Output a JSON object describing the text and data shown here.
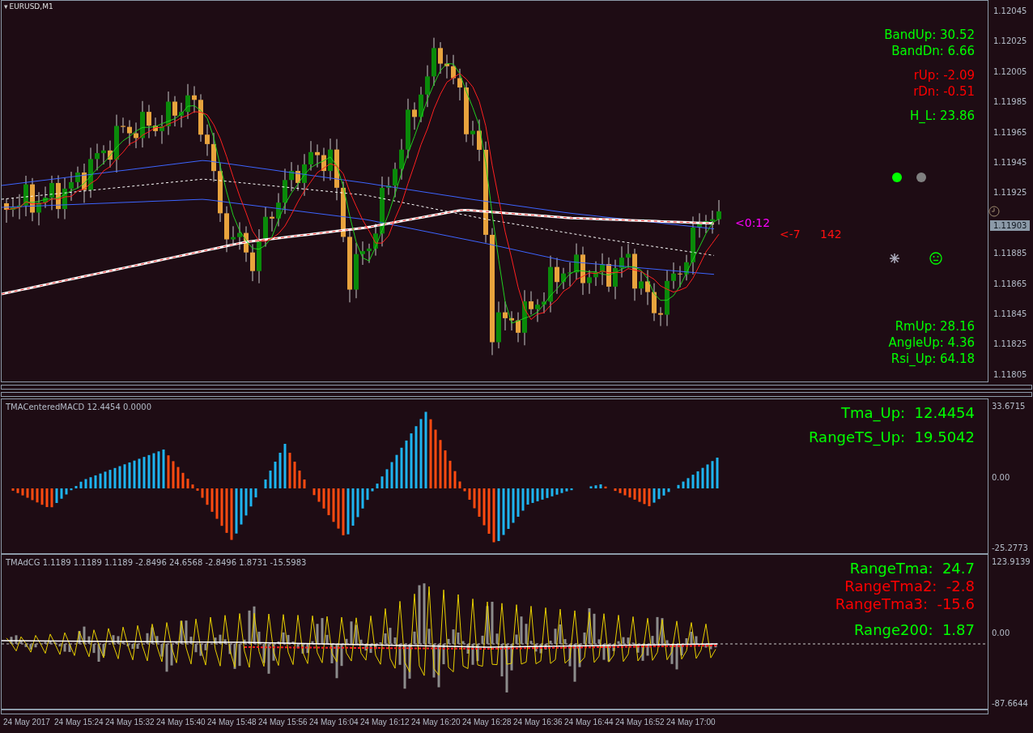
{
  "symbol_menu": "▾",
  "title": "EURUSD,M1",
  "price_axis": {
    "labels": [
      "1.12045",
      "1.12025",
      "1.12005",
      "1.11985",
      "1.11965",
      "1.11945",
      "1.11925",
      "1.11885",
      "1.11865",
      "1.11845",
      "1.11825",
      "1.11805"
    ],
    "current_price": "1.11903"
  },
  "stat_groups": [
    {
      "items": [
        {
          "text": "BandUp: 30.52",
          "color": "#00ff00"
        },
        {
          "text": "BandDn: 6.66",
          "color": "#00ff00"
        }
      ]
    },
    {
      "items": [
        {
          "text": "rUp: -2.09",
          "color": "#ff0000"
        },
        {
          "text": "rDn: -0.51",
          "color": "#ff0000"
        }
      ]
    },
    {
      "items": [
        {
          "text": "H_L: 23.86",
          "color": "#00ff00"
        }
      ]
    }
  ],
  "bottom_stats": [
    {
      "text": "RmUp: 28.16",
      "color": "#00ff00"
    },
    {
      "text": "AngleUp: 4.36",
      "color": "#00ff00"
    },
    {
      "text": "Rsi_Up: 64.18",
      "color": "#00ff00"
    }
  ],
  "signal_dots": [
    {
      "color": "#00ff00"
    },
    {
      "color": "#808080"
    }
  ],
  "timer": "<0:12",
  "spread": "<-7",
  "count": "142",
  "panes": [
    {
      "kind": "macd",
      "title": "TMACenteredMACD 12.4454 0.0000",
      "axis": [
        "33.6715",
        "0.00",
        "-25.2773"
      ],
      "labels": [
        {
          "text": "Tma_Up:  12.4454",
          "color": "#00ff00"
        },
        {
          "text": "RangeTS_Up:  19.5042",
          "color": "#00ff00"
        }
      ]
    },
    {
      "kind": "tmadcg",
      "title": "TMAdCG 1.1189 1.1189 1.1189 -2.8496 24.6568 -2.8496 1.8731 -15.5983",
      "axis": [
        "123.9139",
        "0.00",
        "-87.6644"
      ],
      "labels": [
        {
          "text": "RangeTma:  24.7",
          "color": "#00ff00"
        },
        {
          "text": "RangeTma2:  -2.8",
          "color": "#ff0000"
        },
        {
          "text": "RangeTma3:  -15.6",
          "color": "#ff0000"
        },
        {
          "text": "Range200:  1.87",
          "color": "#00ff00"
        }
      ]
    }
  ],
  "time_axis": [
    "24 May 2017",
    "24 May 15:24",
    "24 May 15:32",
    "24 May 15:40",
    "24 May 15:48",
    "24 May 15:56",
    "24 May 16:04",
    "24 May 16:12",
    "24 May 16:20",
    "24 May 16:28",
    "24 May 16:36",
    "24 May 16:44",
    "24 May 16:52",
    "24 May 17:00"
  ]
}
